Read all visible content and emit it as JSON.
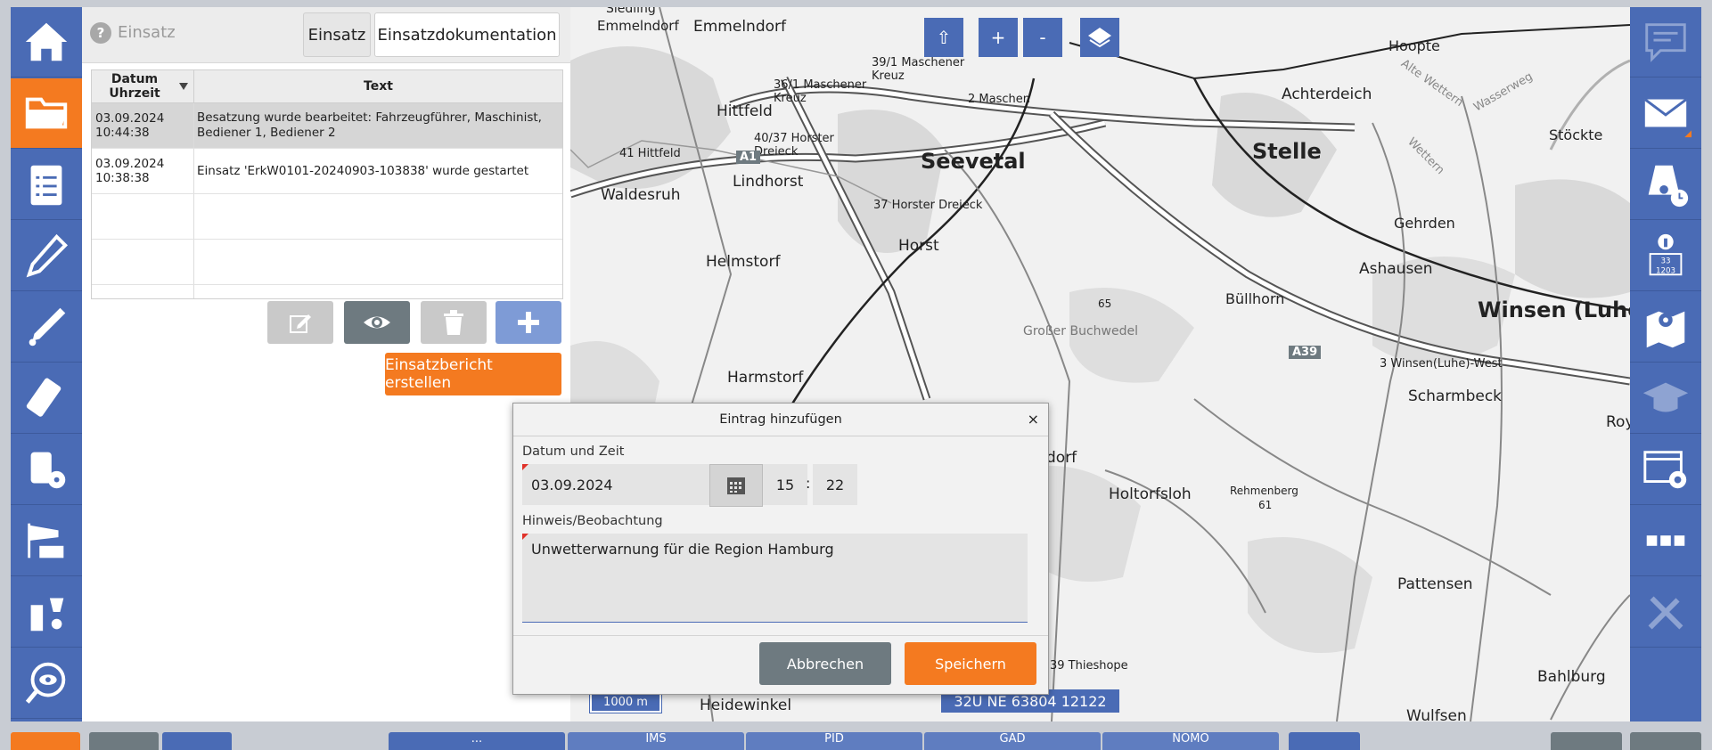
{
  "panel": {
    "title": "Einsatz",
    "tabs": [
      "Einsatz",
      "Einsatzdokumentation"
    ],
    "table": {
      "columns": [
        "Datum\nUhrzeit",
        "Text"
      ],
      "rows": [
        {
          "date": "03.09.2024",
          "time": "10:44:38",
          "text": "Besatzung wurde bearbeitet: Fahrzeugführer, Maschinist, Bediener 1, Bediener 2"
        },
        {
          "date": "03.09.2024",
          "time": "10:38:38",
          "text": "Einsatz 'ErkW0101-20240903-103838' wurde gestartet"
        }
      ]
    },
    "report_button": "Einsatzbericht erstellen"
  },
  "map": {
    "labels": {
      "seevetal": "Seevetal",
      "stelle": "Stelle",
      "winsen": "Winsen (Luhe",
      "emmelndorf": "Emmelndorf",
      "hittfeld": "Hittfeld",
      "lindhorst": "Lindhorst",
      "waldesruh": "Waldesruh",
      "horst": "Horst",
      "helmstorf": "Helmstorf",
      "harmstorf": "Harmstorf",
      "buellhorn": "Büllhorn",
      "ashausen": "Ashausen",
      "achterdeich": "Achterdeich",
      "hoopte": "Hoopte",
      "stoeckte": "Stöckte",
      "gehrden": "Gehrden",
      "scharmbeck": "Scharmbeck",
      "holtorfsloh": "Holtorfsloh",
      "pattensen": "Pattensen",
      "bahlburg": "Bahlburg",
      "heidewinkel": "Heidewinkel",
      "grosser_buchwedel": "Großer Buchwedel",
      "rehmenberg": "Rehmenberg",
      "rehmenberg_height": "61",
      "height_65": "65",
      "junction_39_1": "39/1 Maschener Kreuz",
      "junction_36_1": "36/1 Maschener Kreuz",
      "junction_40_37": "40/37 Horster Dreieck",
      "junction_37": "37 Horster Dreieck",
      "junction_41": "41 Hittfeld",
      "junction_2": "2 Maschen",
      "junction_3": "3 Winsen(Luhe)-West",
      "junction_39": "39 Thieshope",
      "a1": "A1",
      "a39": "A39",
      "alte_wettern": "Alte Wettern",
      "wettern": "Wettern",
      "wassereweg": "Wasserweg",
      "roy": "Roy",
      "dorf": "dorf",
      "sieding": "Siedling",
      "wulfsen": "Wulfsen"
    },
    "controls": {
      "home": "⇧",
      "zoom_in": "+",
      "zoom_out": "-"
    },
    "scale": "1000 m",
    "coordinates": "32U NE 63804 12122"
  },
  "dialog": {
    "title": "Eintrag hinzufügen",
    "close": "×",
    "date_label": "Datum und Zeit",
    "date_value": "03.09.2024",
    "hour": "15",
    "minute": "22",
    "time_separator": ":",
    "note_label": "Hinweis/Beobachtung",
    "note_value": "Unwetterwarnung für die Region Hamburg",
    "cancel": "Abbrechen",
    "save": "Speichern"
  },
  "bottom_tabs": [
    "...",
    "IMS",
    "PID",
    "GAD",
    "NOMO"
  ],
  "icons": {
    "left": [
      "home-icon",
      "folder-icon",
      "checklist-icon",
      "pen-icon",
      "probe-icon",
      "meter-icon",
      "radiation-meter-icon",
      "windsock-icon",
      "chemical-icon",
      "eye-search-icon"
    ],
    "right": [
      "chat-icon",
      "mail-icon",
      "vehicle-clock-icon",
      "info-icon",
      "map-pin-icon",
      "graduation-icon",
      "settings-window-icon",
      "more-icon",
      "tools-icon"
    ]
  },
  "colors": {
    "accent": "#f47a20",
    "sidebar": "#4a6bb5"
  }
}
